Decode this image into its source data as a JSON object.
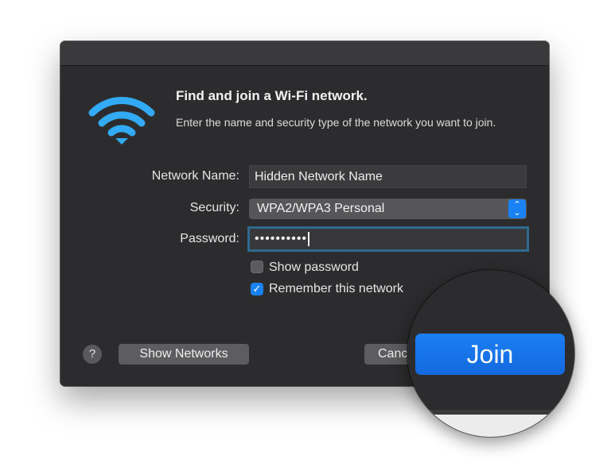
{
  "dialog": {
    "title": "Find and join a Wi-Fi network.",
    "description": "Enter the name and security type of the network you want to join."
  },
  "form": {
    "network_name_label": "Network Name:",
    "network_name_value": "Hidden Network Name",
    "security_label": "Security:",
    "security_value": "WPA2/WPA3 Personal",
    "password_label": "Password:",
    "password_value": "••••••••••",
    "show_password_label": "Show password",
    "show_password_checked": false,
    "remember_label": "Remember this network",
    "remember_checked": true
  },
  "buttons": {
    "help": "?",
    "show_networks": "Show Networks",
    "cancel": "Canc",
    "join": "Join"
  },
  "icons": {
    "wifi": "wifi-icon",
    "select_arrows": "up-down-chevron-icon",
    "checkmark": "checkmark-icon"
  },
  "colors": {
    "accent": "#1a82f7",
    "dialog_bg": "#2c2c2e",
    "wifi_icon": "#33aaf5"
  }
}
